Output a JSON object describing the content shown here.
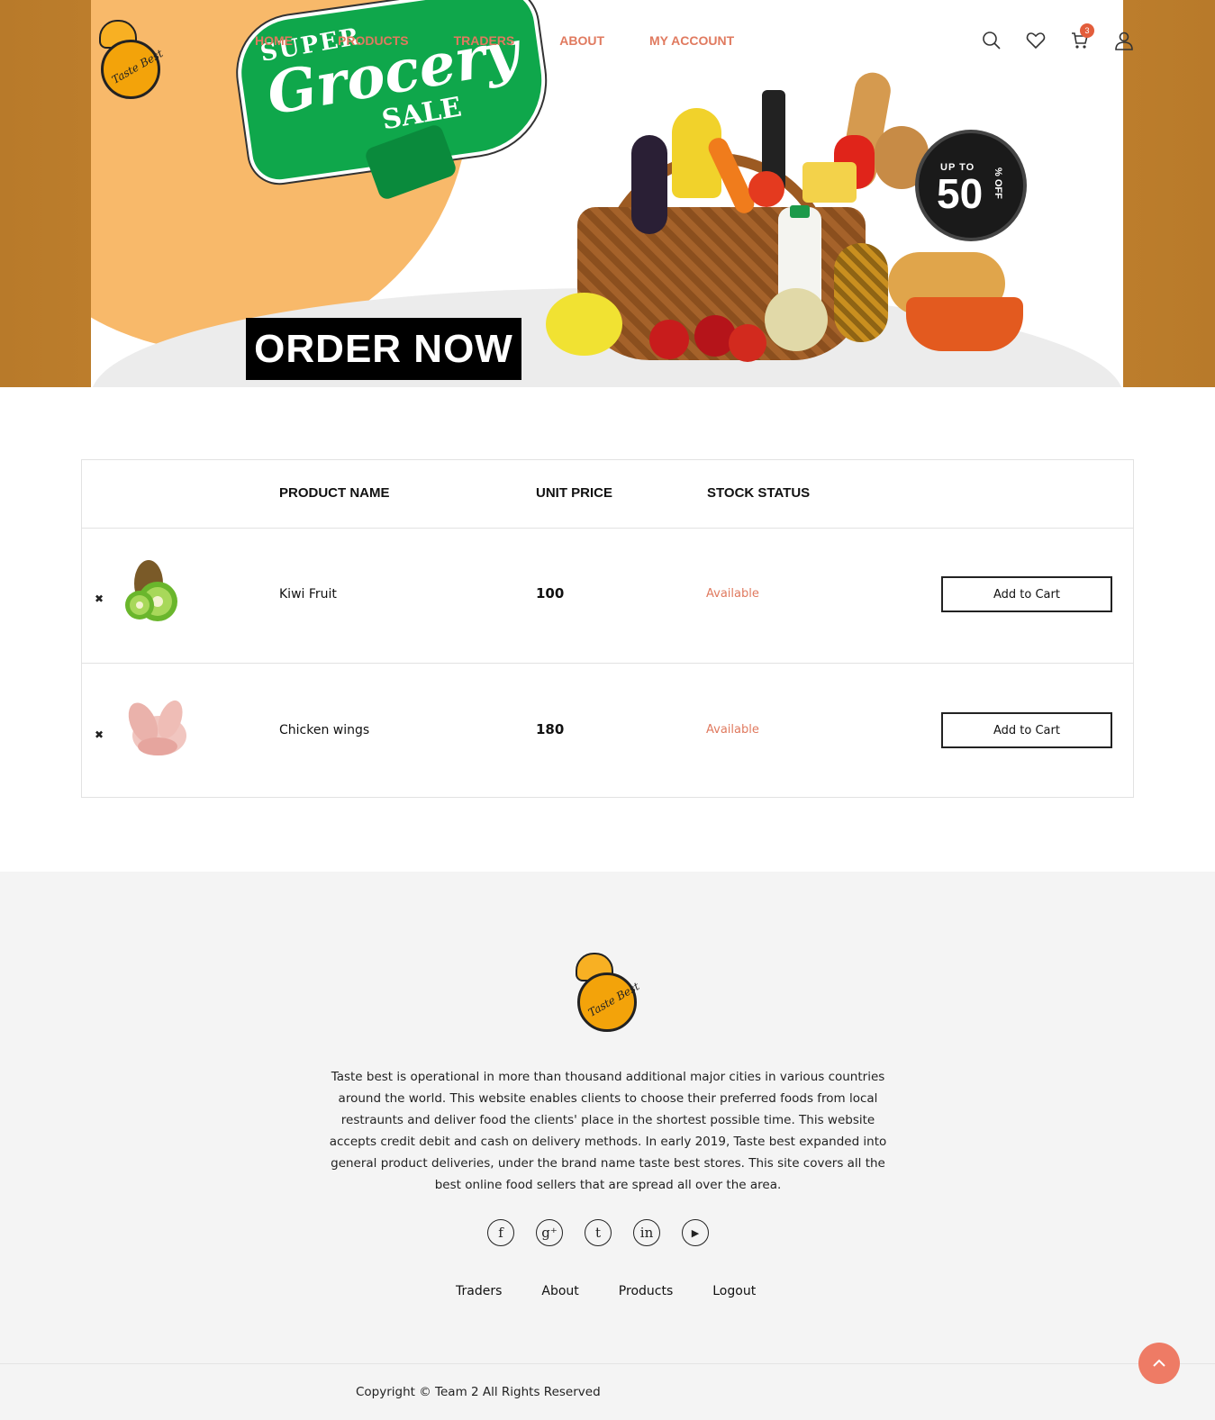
{
  "brand": {
    "logo_text": "Taste Best"
  },
  "nav": {
    "items": [
      {
        "label": "HOME"
      },
      {
        "label": "PRODUCTS"
      },
      {
        "label": "TRADERS"
      },
      {
        "label": "ABOUT"
      },
      {
        "label": "MY ACCOUNT"
      }
    ],
    "cart_count": "3",
    "icons": [
      "search-icon",
      "heart-icon",
      "cart-icon",
      "user-icon"
    ],
    "accent_color": "#e07a5f"
  },
  "hero": {
    "tagline_top": "SUPER",
    "tagline_main": "Grocery",
    "tagline_bottom": "SALE",
    "cta": "ORDER NOW",
    "badge_prefix": "UP TO",
    "badge_value": "50",
    "badge_suffix": "% OFF"
  },
  "wishlist": {
    "headers": [
      "PRODUCT NAME",
      "UNIT PRICE",
      "STOCK STATUS"
    ],
    "remove_glyph": "✖",
    "rows": [
      {
        "name": "Kiwi Fruit",
        "price": "100",
        "stock": "Available",
        "action": "Add to Cart",
        "image_icon": "kiwi-image"
      },
      {
        "name": "Chicken wings",
        "price": "180",
        "stock": "Available",
        "action": "Add to Cart",
        "image_icon": "chicken-wings-image"
      }
    ]
  },
  "footer": {
    "description": "Taste best is operational in more than thousand additional major cities in various countries around the world. This website enables clients to choose their preferred foods from local restraunts and deliver food the clients' place in the shortest possible time. This website accepts credit debit and cash on delivery methods. In early 2019, Taste best expanded into general product deliveries, under the brand name taste best stores. This site covers all the best online food sellers that are spread all over the area.",
    "social": [
      {
        "glyph": "f",
        "icon": "facebook-icon"
      },
      {
        "glyph": "g⁺",
        "icon": "google-plus-icon"
      },
      {
        "glyph": "t",
        "icon": "tumblr-icon"
      },
      {
        "glyph": "in",
        "icon": "linkedin-icon"
      },
      {
        "glyph": "▶",
        "icon": "youtube-icon"
      }
    ],
    "links": [
      {
        "label": "Traders"
      },
      {
        "label": "About"
      },
      {
        "label": "Products"
      },
      {
        "label": "Logout"
      }
    ],
    "copyright": "Copyright © Team 2 All Rights Reserved"
  }
}
